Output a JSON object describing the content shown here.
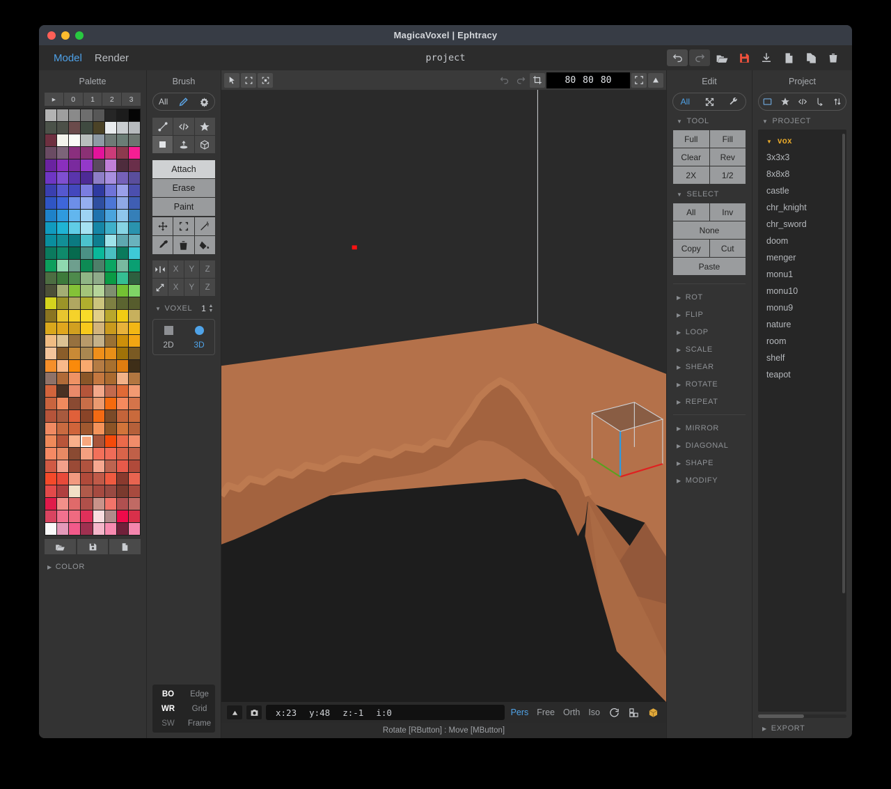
{
  "window": {
    "title": "MagicaVoxel | Ephtracy"
  },
  "menu": {
    "items": [
      {
        "label": "Model",
        "active": true
      },
      {
        "label": "Render",
        "active": false
      }
    ]
  },
  "topbar": {
    "project_name": "project",
    "icons": [
      {
        "name": "undo-icon",
        "label": "undo"
      },
      {
        "name": "redo-icon",
        "label": "redo"
      },
      {
        "name": "open-folder-icon",
        "label": "open"
      },
      {
        "name": "save-icon",
        "label": "save",
        "color": "#f0513c"
      },
      {
        "name": "download-icon",
        "label": "export"
      },
      {
        "name": "new-file-icon",
        "label": "new"
      },
      {
        "name": "duplicate-icon",
        "label": "duplicate"
      },
      {
        "name": "trash-icon",
        "label": "delete"
      }
    ]
  },
  "palette": {
    "title": "Palette",
    "tabs": [
      "▸",
      "0",
      "1",
      "2",
      "3"
    ],
    "selected_index": 211,
    "footer_buttons": [
      "open-palette-icon",
      "save-palette-icon",
      "new-palette-icon"
    ],
    "color_section": "COLOR",
    "colors": [
      "#b3b3b3",
      "#9e9e9e",
      "#8a8a8a",
      "#6e6e6e",
      "#575757",
      "#262626",
      "#1c1c1c",
      "#050505",
      "#4b5249",
      "#4c5048",
      "#6b4b4b",
      "#3f4a40",
      "#4b4327",
      "#e9ecee",
      "#c9cdd0",
      "#b6babd",
      "#6e3040",
      "#f3f4ec",
      "#fbfbf7",
      "#b8bfbd",
      "#8e9aa4",
      "#6f7a76",
      "#6b7d76",
      "#6c7570",
      "#6a4b63",
      "#7c6479",
      "#8a2f7e",
      "#8b3175",
      "#e4139b",
      "#cc3b79",
      "#8d3a4e",
      "#f51e93",
      "#6a23a1",
      "#8a2fbd",
      "#7a2a9e",
      "#9439c9",
      "#5a4a5e",
      "#c07fd8",
      "#4e2c3d",
      "#6a2f4a",
      "#6e36c4",
      "#7f4fd1",
      "#5a35ad",
      "#4e2b96",
      "#8e7fc7",
      "#a88fe0",
      "#7561b9",
      "#5a4e9c",
      "#3a3fb0",
      "#5558cf",
      "#4348bd",
      "#7b7de0",
      "#2f3aa0",
      "#6f73d8",
      "#9aa0ea",
      "#4b4fae",
      "#2f55c4",
      "#3e66da",
      "#6d8fe8",
      "#95aef0",
      "#2e4ea0",
      "#4c76d6",
      "#8fa9e6",
      "#3f5eb3",
      "#1e82c9",
      "#2f9ade",
      "#62b6ee",
      "#9ed3f4",
      "#2073ae",
      "#4aa4dd",
      "#8ec6ec",
      "#357fb8",
      "#119bbf",
      "#1fb4d4",
      "#60cde6",
      "#a6e2f2",
      "#1586a6",
      "#3fb0c9",
      "#86d4e4",
      "#2a93ae",
      "#0a8e9e",
      "#128f96",
      "#0b7a81",
      "#4cc2cd",
      "#0e7d8f",
      "#9fe3ea",
      "#5fa8b0",
      "#6ab2bd",
      "#0b7a5e",
      "#0f8a6b",
      "#066a4e",
      "#4b9185",
      "#0ab89a",
      "#49bfc1",
      "#0a7a5c",
      "#3ec9d6",
      "#0c9f5c",
      "#8fd9b0",
      "#6e9f8e",
      "#0d8a54",
      "#4d7f69",
      "#0aa662",
      "#78b9a0",
      "#0a9f72",
      "#4d6d42",
      "#3d7a3b",
      "#4e8a4c",
      "#8fb585",
      "#8fab8a",
      "#0a9b45",
      "#35bf93",
      "#2e5f3f",
      "#4c5038",
      "#a3ad74",
      "#84c237",
      "#a3c47a",
      "#b5d49a",
      "#7f8f70",
      "#74c133",
      "#7fd466",
      "#d4d41e",
      "#9c9428",
      "#b0a761",
      "#b0ae2e",
      "#cbc47d",
      "#7e8042",
      "#5b6430",
      "#565c2d",
      "#8a7421",
      "#e8c52f",
      "#f5d22a",
      "#f7db29",
      "#e2cf88",
      "#b9a72c",
      "#f2cc13",
      "#c7b05d",
      "#d9a71c",
      "#e0a71e",
      "#d1a020",
      "#f7c91c",
      "#d3b47c",
      "#c99a1d",
      "#e8b23a",
      "#f2b714",
      "#f0bc83",
      "#dcc293",
      "#97713f",
      "#b89a6a",
      "#c4b18a",
      "#9a7134",
      "#cc8f0a",
      "#f2a613",
      "#f3c49b",
      "#8a5d2a",
      "#c98a36",
      "#a98750",
      "#ef8f1a",
      "#e88f18",
      "#a07208",
      "#7a5a23",
      "#f58f2a",
      "#f9b98a",
      "#fa8a0a",
      "#f9a96e",
      "#b57c44",
      "#a8702f",
      "#e07d10",
      "#3e2e18",
      "#8f7268",
      "#b06a38",
      "#ef9264",
      "#8a5628",
      "#c47840",
      "#aa6a2f",
      "#f2b288",
      "#b27640",
      "#d2643c",
      "#4a3123",
      "#ea8a6a",
      "#b5553a",
      "#f3a88a",
      "#c36a4d",
      "#e06a36",
      "#f29a72",
      "#c9643e",
      "#f08a5e",
      "#8a4a32",
      "#c86e48",
      "#ea9a70",
      "#f56a0e",
      "#f58a5e",
      "#d4744a",
      "#b5543a",
      "#a85a3e",
      "#e0603a",
      "#8a4428",
      "#f36a14",
      "#7a4a28",
      "#c4643a",
      "#c96a3c",
      "#f08a62",
      "#c96a40",
      "#d0643a",
      "#a0582f",
      "#f4935a",
      "#8c5426",
      "#d2743a",
      "#b5603a",
      "#ef8a5a",
      "#b9553a",
      "#f9b08a",
      "#f9a87e",
      "#a8543a",
      "#f44a0a",
      "#ea6a4a",
      "#f08c6a",
      "#f58a64",
      "#e88a64",
      "#8a4a32",
      "#f4a080",
      "#f2705a",
      "#f06c58",
      "#d9644a",
      "#c06048",
      "#d05a44",
      "#f2a08a",
      "#9a4a36",
      "#b0533f",
      "#f6a890",
      "#bd6450",
      "#e85a4a",
      "#b04a3a",
      "#f44a2a",
      "#e84a3a",
      "#f29a80",
      "#b04a3a",
      "#c05a48",
      "#ef5a40",
      "#8a3a2e",
      "#e86450",
      "#e34a4a",
      "#b04040",
      "#f2e0c7",
      "#b05a4a",
      "#a64a40",
      "#994a42",
      "#7a3a2e",
      "#a84a3e",
      "#e01a4a",
      "#f2908a",
      "#e06a6a",
      "#b0504a",
      "#c9938a",
      "#f2746a",
      "#b05050",
      "#c06a64",
      "#d94460",
      "#f2718f",
      "#ef6a80",
      "#e0305a",
      "#f9dde0",
      "#b08a8a",
      "#ef0a4a",
      "#d9304a",
      "#fafafa",
      "#e49aba",
      "#f25a8a",
      "#a03050",
      "#f5b6ca",
      "#f88ab0",
      "#70203a",
      "#f486ae"
    ]
  },
  "brush": {
    "title": "Brush",
    "mode_group": [
      "All",
      "brush-icon",
      "gear-icon"
    ],
    "shape_buttons": [
      "line-icon",
      "code-icon",
      "star-icon",
      "voxel-icon",
      "pattern-icon",
      "box-icon"
    ],
    "active_shape_index": 3,
    "modes": [
      {
        "label": "Attach",
        "active": true
      },
      {
        "label": "Erase",
        "active": false
      },
      {
        "label": "Paint",
        "active": false
      }
    ],
    "tools": [
      "move-icon",
      "select-icon",
      "magic-wand-icon",
      "eyedropper-icon",
      "trash-icon",
      "bucket-fill-icon"
    ],
    "mirror_row": {
      "icon": "mirror-icon",
      "axes": [
        "X",
        "Y",
        "Z"
      ]
    },
    "scale_row": {
      "icon": "resize-icon",
      "axes": [
        "X",
        "Y",
        "Z"
      ]
    },
    "voxel_label": "VOXEL",
    "voxel_value": "1",
    "dimension": {
      "options": [
        "2D",
        "3D"
      ],
      "active": "3D"
    },
    "display_toggles": [
      {
        "key": "BO",
        "label": "Edge",
        "key_on": true,
        "label_on": false
      },
      {
        "key": "WR",
        "label": "Grid",
        "key_on": true,
        "label_on": false
      },
      {
        "key": "SW",
        "label": "Frame",
        "key_on": false,
        "label_on": false
      }
    ]
  },
  "viewport": {
    "toolbar_left": [
      "cursor-icon",
      "marquee-select-icon",
      "box-select-icon"
    ],
    "toolbar_right": [
      "undo-icon",
      "redo-icon",
      "crop-icon"
    ],
    "size": [
      "80",
      "80",
      "80"
    ],
    "fit_icon": "fit-icon",
    "up-icon": "triangle-up-icon",
    "model_color": "#b06a42",
    "background": "#2a2a2a",
    "cursor_marker_color": "#ff1111"
  },
  "statusbar": {
    "expand_icon": "triangle-up-icon",
    "camera_icon": "camera-icon",
    "coords": [
      "x:23",
      "y:48",
      "z:-1",
      "i:0"
    ],
    "view_modes": [
      {
        "label": "Pers",
        "active": true
      },
      {
        "label": "Free",
        "active": false
      },
      {
        "label": "Orth",
        "active": false
      },
      {
        "label": "Iso",
        "active": false
      }
    ],
    "extra_icons": [
      "rotate-icon",
      "grid-view-icon",
      "cube-icon"
    ],
    "hint": "Rotate [RButton] : Move [MButton]"
  },
  "edit": {
    "title": "Edit",
    "mode_group": [
      "All",
      "transform-icon",
      "wrench-icon"
    ],
    "tool_label": "TOOL",
    "tool_buttons": [
      "Full",
      "Fill",
      "Clear",
      "Rev",
      "2X",
      "1/2"
    ],
    "select_label": "SELECT",
    "select_buttons": [
      "All",
      "Inv",
      "None",
      "Copy",
      "Cut",
      "Paste"
    ],
    "sections_a": [
      "ROT",
      "FLIP",
      "LOOP",
      "SCALE",
      "SHEAR",
      "ROTATE",
      "REPEAT"
    ],
    "sections_b": [
      "MIRROR",
      "DIAGONAL",
      "SHAPE",
      "MODIFY"
    ]
  },
  "project": {
    "title": "Project",
    "toolbar_icons": [
      "folder-icon",
      "star-icon",
      "code-icon",
      "branch-icon",
      "sort-icon"
    ],
    "section_label": "PROJECT",
    "root": "vox",
    "files": [
      "3x3x3",
      "8x8x8",
      "castle",
      "chr_knight",
      "chr_sword",
      "doom",
      "menger",
      "monu1",
      "monu10",
      "monu9",
      "nature",
      "room",
      "shelf",
      "teapot"
    ],
    "export_label": "EXPORT"
  }
}
